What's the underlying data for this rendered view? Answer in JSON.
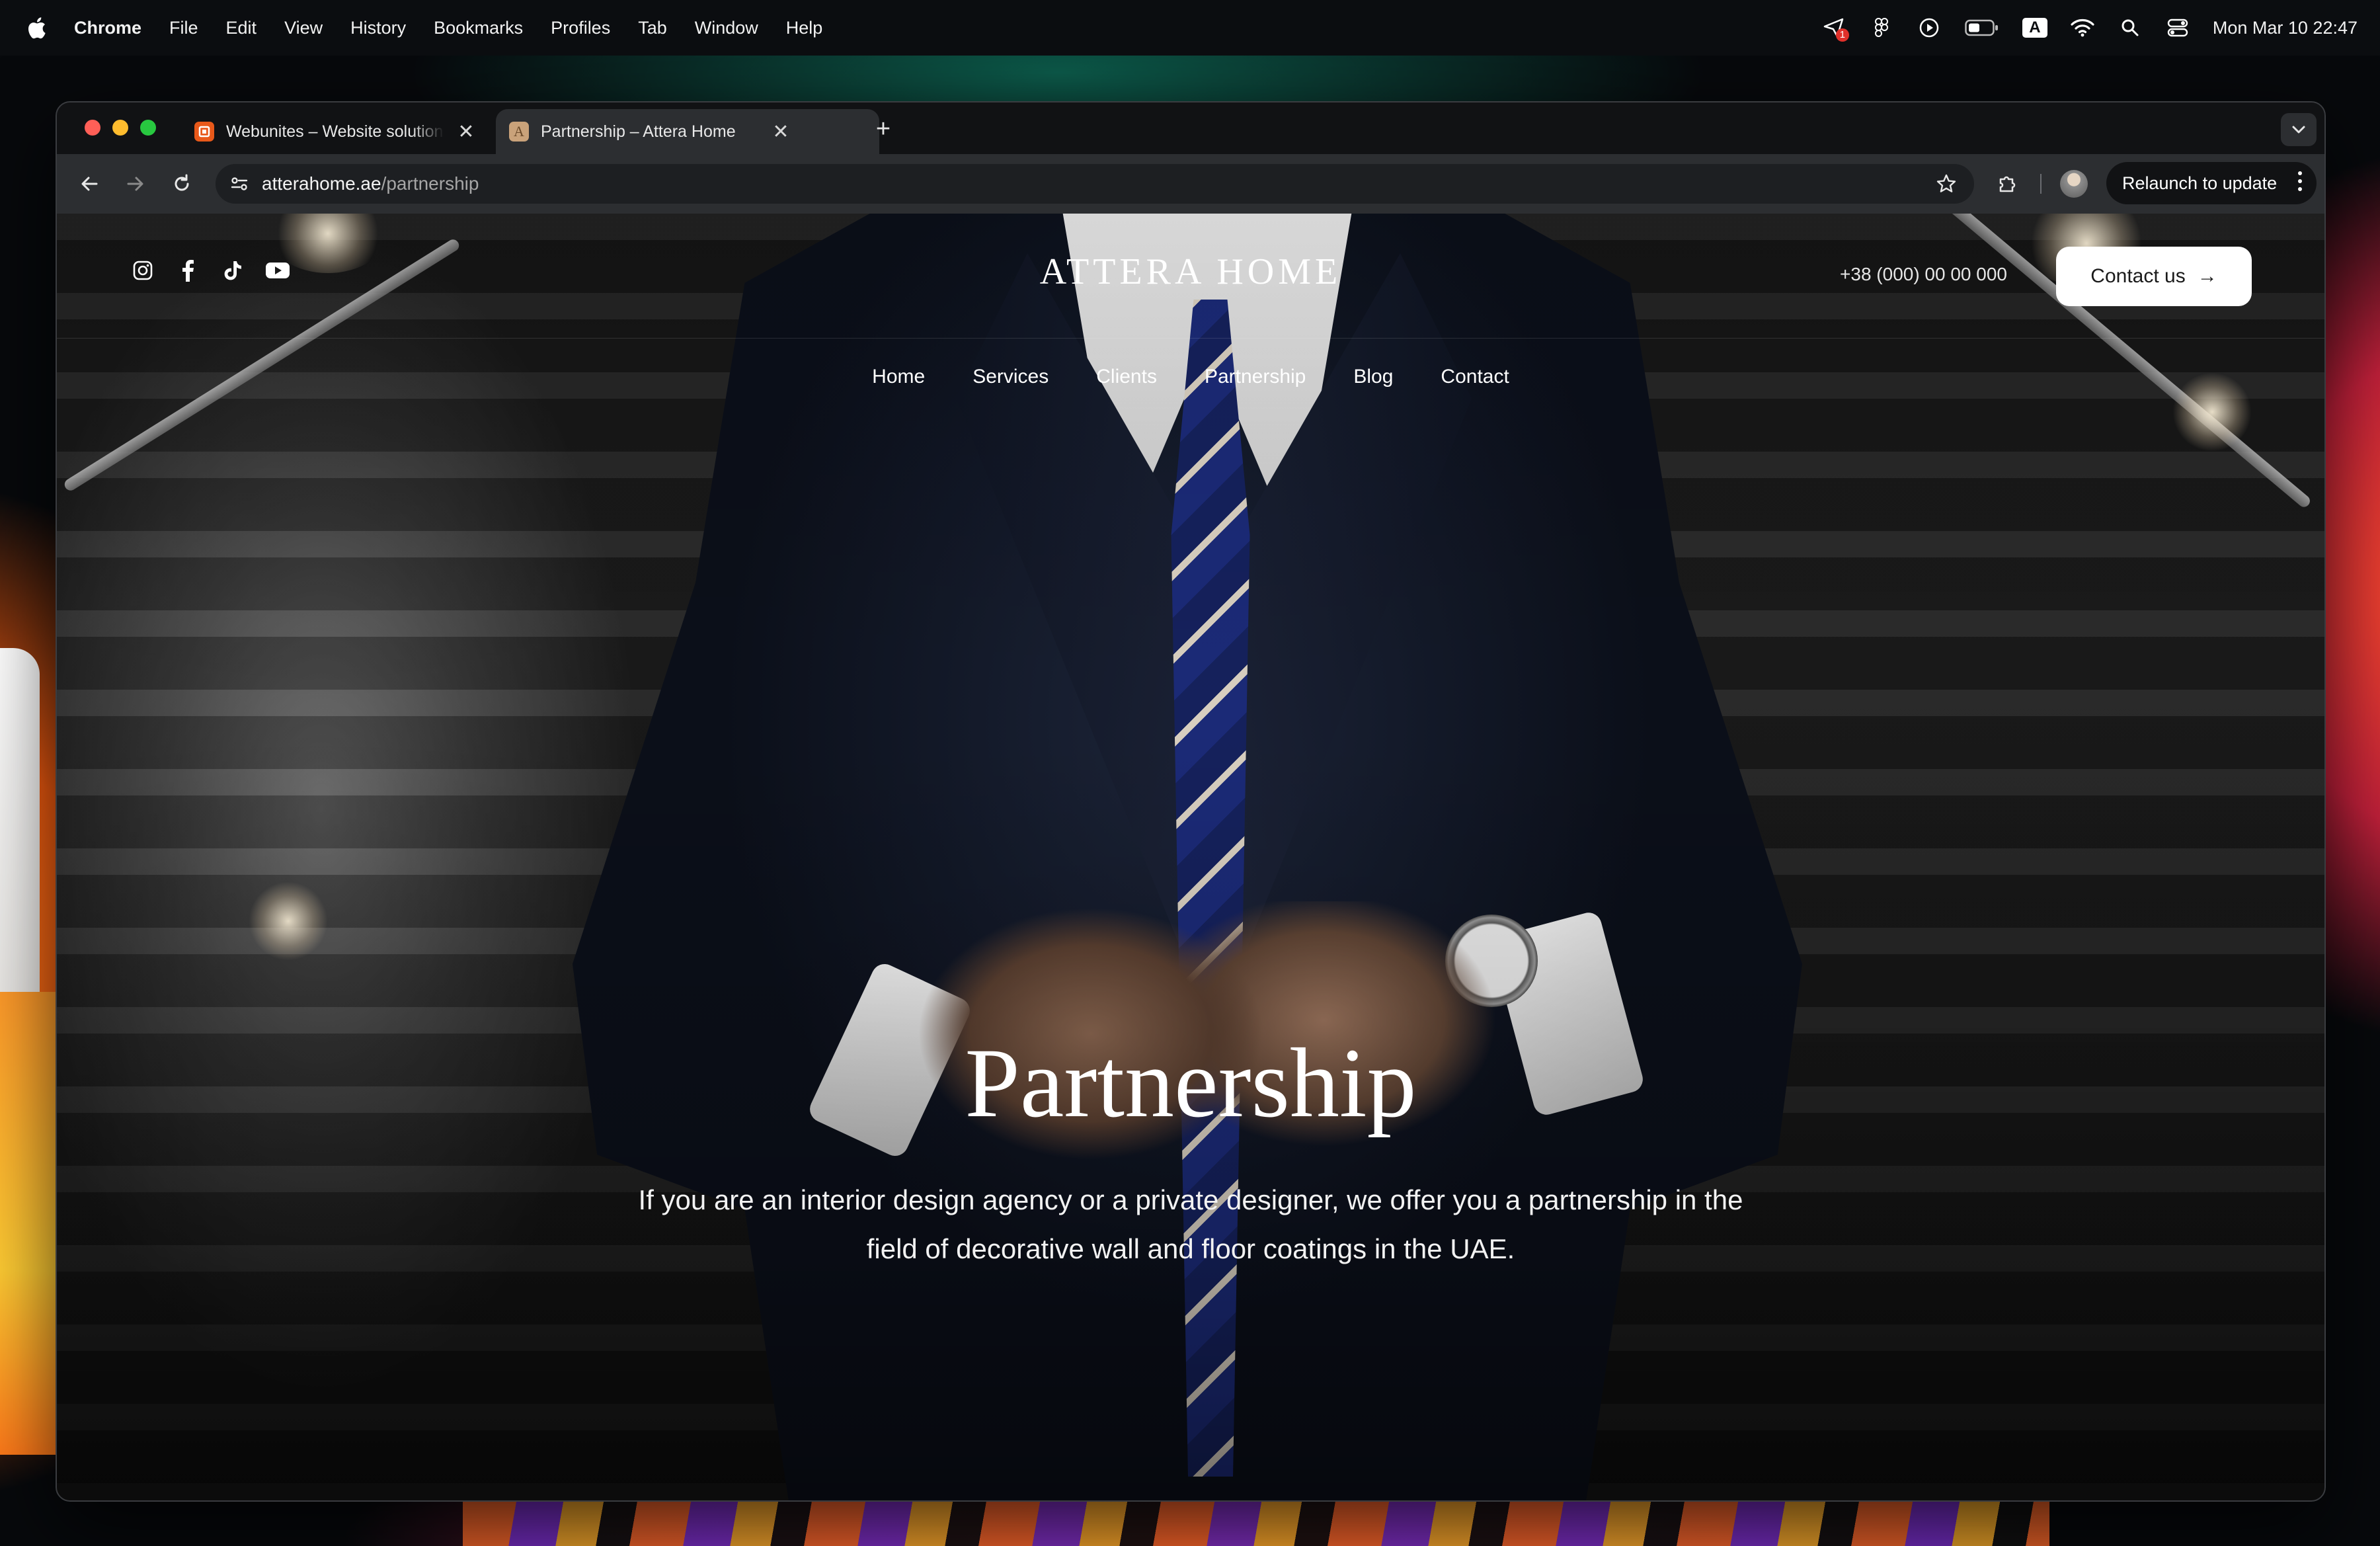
{
  "menubar": {
    "app_name": "Chrome",
    "items": [
      "File",
      "Edit",
      "View",
      "History",
      "Bookmarks",
      "Profiles",
      "Tab",
      "Window",
      "Help"
    ],
    "badge_count": "1",
    "clock": "Mon Mar 10  22:47",
    "keyboard_indicator": "A"
  },
  "browser": {
    "tabs": [
      {
        "title": "Webunites – Website solution",
        "active": false,
        "favicon_color": "#e8591a"
      },
      {
        "title": "Partnership – Attera Home",
        "active": true,
        "favicon_color": "#c9a27a",
        "favicon_letter": "A"
      }
    ],
    "url_domain": "atterahome.ae",
    "url_path": "/partnership",
    "relaunch_label": "Relaunch to update"
  },
  "site": {
    "logo": "ATTERA HOME",
    "phone": "+38 (000) 00 00 000",
    "contact_button": "Contact us",
    "contact_arrow": "→",
    "nav": [
      "Home",
      "Services",
      "Clients",
      "Partnership",
      "Blog",
      "Contact"
    ],
    "socials": [
      "instagram-icon",
      "facebook-icon",
      "tiktok-icon",
      "youtube-icon"
    ]
  },
  "hero": {
    "title": "Partnership",
    "text": "If you are an interior design agency or a private designer, we offer you a partnership in the field of decorative wall and floor coatings in the UAE."
  }
}
